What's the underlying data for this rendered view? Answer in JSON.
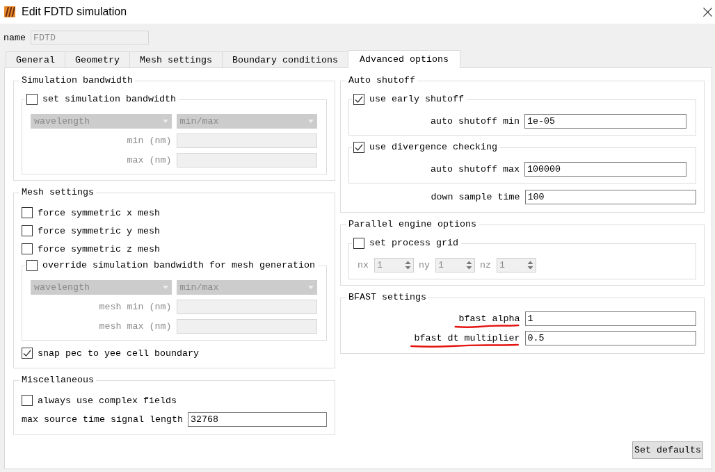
{
  "window": {
    "title": "Edit FDTD simulation"
  },
  "name_field": {
    "label": "name",
    "value": "FDTD",
    "disabled": true
  },
  "tabs": [
    {
      "label": "General",
      "selected": false
    },
    {
      "label": "Geometry",
      "selected": false
    },
    {
      "label": "Mesh settings",
      "selected": false
    },
    {
      "label": "Boundary conditions",
      "selected": false
    },
    {
      "label": "Advanced options",
      "selected": true
    }
  ],
  "columns": [
    {
      "groups": [
        {
          "title": "Simulation bandwidth",
          "items": [
            {
              "kind": "check_group",
              "label": "set simulation bandwidth",
              "checked": false,
              "items": [
                {
                  "kind": "dropdowns",
                  "dropdowns": [
                    {
                      "value": "wavelength"
                    },
                    {
                      "value": "min/max"
                    }
                  ]
                },
                {
                  "kind": "field",
                  "label": "min (nm)"
                },
                {
                  "kind": "field",
                  "label": "max (nm)"
                }
              ]
            }
          ]
        },
        {
          "title": "Mesh settings",
          "items": [
            {
              "kind": "checkbox",
              "label": "force symmetric x mesh",
              "checked": false
            },
            {
              "kind": "checkbox",
              "label": "force symmetric y mesh",
              "checked": false
            },
            {
              "kind": "checkbox",
              "label": "force symmetric z mesh",
              "checked": false
            },
            {
              "kind": "check_group",
              "label": "override simulation bandwidth for mesh generation",
              "checked": false,
              "items": [
                {
                  "kind": "dropdowns",
                  "dropdowns": [
                    {
                      "value": "wavelength"
                    },
                    {
                      "value": "min/max"
                    }
                  ]
                },
                {
                  "kind": "field",
                  "label": "mesh min (nm)"
                },
                {
                  "kind": "field",
                  "label": "mesh max (nm)"
                }
              ]
            },
            {
              "kind": "checkbox",
              "label": "snap pec to yee cell boundary",
              "checked": true
            }
          ]
        },
        {
          "title": "Miscellaneous",
          "items": [
            {
              "kind": "checkbox",
              "label": "always use complex fields",
              "checked": false
            },
            {
              "kind": "field",
              "label": "max source time signal length",
              "value": "32768"
            }
          ]
        }
      ]
    },
    {
      "groups": [
        {
          "title": "Auto shutoff",
          "items": [
            {
              "kind": "check_group",
              "label": "use early shutoff",
              "checked": true,
              "items": [
                {
                  "kind": "field",
                  "label": "auto shutoff min",
                  "value": "1e-05"
                }
              ]
            },
            {
              "kind": "check_group",
              "label": "use divergence checking",
              "checked": true,
              "items": [
                {
                  "kind": "field",
                  "label": "auto shutoff max",
                  "value": "100000"
                }
              ]
            },
            {
              "kind": "field",
              "label": "down sample time",
              "value": "100"
            }
          ]
        },
        {
          "title": "Parallel engine options",
          "items": [
            {
              "kind": "check_group",
              "label": "set process grid",
              "checked": false,
              "items": [
                {
                  "kind": "spins",
                  "spins": [
                    {
                      "label": "nx",
                      "value": "1"
                    },
                    {
                      "label": "ny",
                      "value": "1"
                    },
                    {
                      "label": "nz",
                      "value": "1"
                    }
                  ]
                }
              ]
            }
          ]
        },
        {
          "title": "BFAST settings",
          "items": [
            {
              "kind": "field",
              "label": "bfast alpha",
              "value": "1",
              "underlined": true
            },
            {
              "kind": "field",
              "label": "bfast dt multiplier",
              "value": "0.5",
              "underlined": true
            }
          ]
        }
      ]
    }
  ],
  "buttons": [
    {
      "label": "Set defaults"
    }
  ]
}
